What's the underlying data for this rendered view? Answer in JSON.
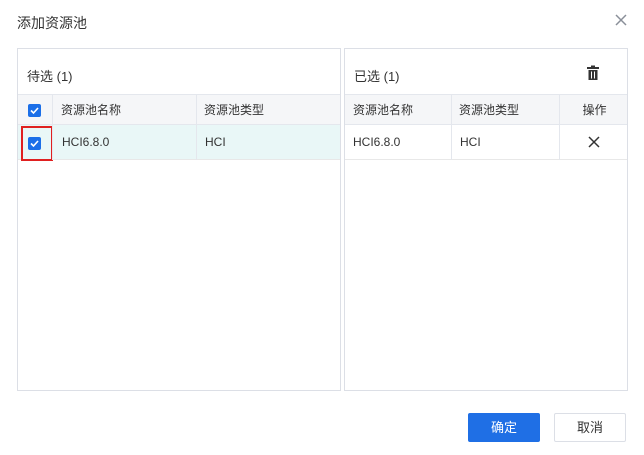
{
  "dialog": {
    "title": "添加资源池",
    "close_icon": "close-icon"
  },
  "left_panel": {
    "title": "待选 (1)",
    "columns": [
      "资源池名称",
      "资源池类型"
    ],
    "header_checkbox_checked": true,
    "rows": [
      {
        "name": "HCI6.8.0",
        "type": "HCI",
        "checked": true
      }
    ]
  },
  "right_panel": {
    "title": "已选 (1)",
    "trash_icon": "trash-icon",
    "columns": [
      "资源池名称",
      "资源池类型",
      "操作"
    ],
    "rows": [
      {
        "name": "HCI6.8.0",
        "type": "HCI",
        "action_icon": "close-icon"
      }
    ]
  },
  "footer": {
    "confirm_label": "确定",
    "cancel_label": "取消"
  },
  "colors": {
    "primary": "#1f6fe5",
    "selected_row": "#e9f7f7",
    "highlight": "#e02020"
  }
}
